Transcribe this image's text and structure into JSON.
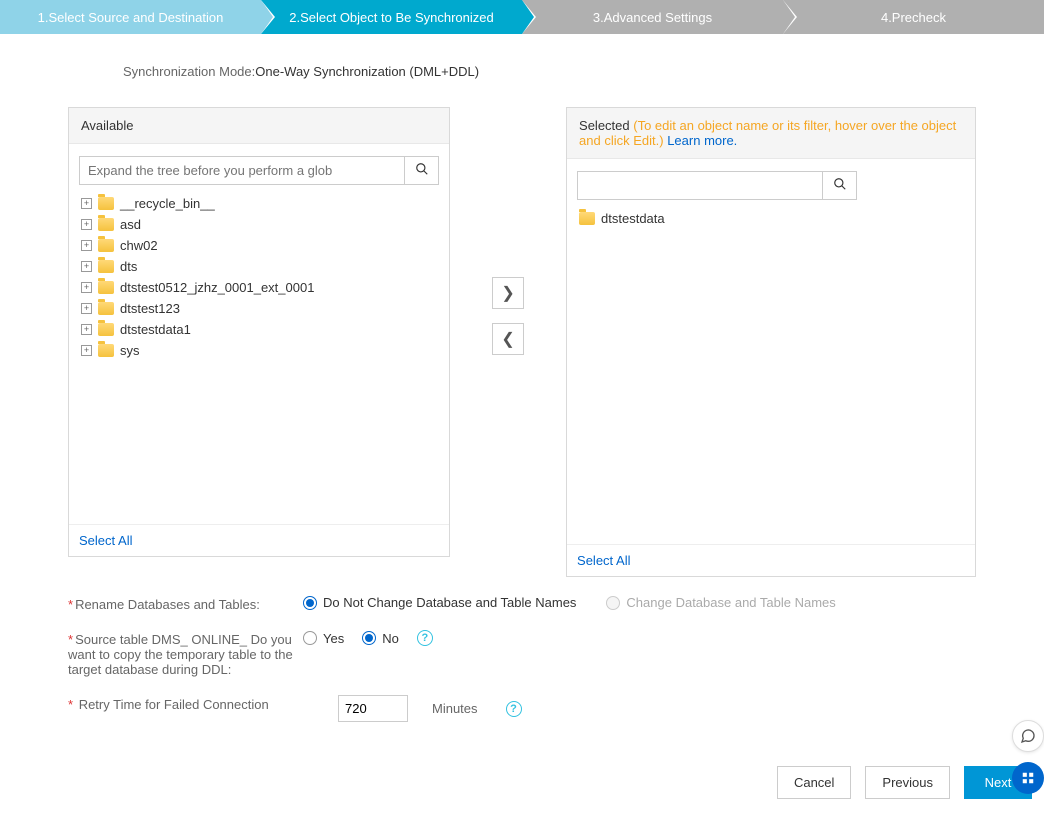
{
  "steps": {
    "s1": "1.Select Source and Destination",
    "s2": "2.Select Object to Be Synchronized",
    "s3": "3.Advanced Settings",
    "s4": "4.Precheck"
  },
  "sync_mode": {
    "label": "Synchronization Mode:",
    "value": "One-Way Synchronization (DML+DDL)"
  },
  "available": {
    "title": "Available",
    "search_placeholder": "Expand the tree before you perform a glob",
    "select_all": "Select All",
    "items": [
      "__recycle_bin__",
      "asd",
      "chw02",
      "dts",
      "dtstest0512_jzhz_0001_ext_0001",
      "dtstest123",
      "dtstestdata1",
      "sys"
    ]
  },
  "selected": {
    "title": "Selected",
    "hint": "(To edit an object name or its filter, hover over the object and click Edit.)",
    "learn_more": "Learn more.",
    "select_all": "Select All",
    "items": [
      "dtstestdata"
    ]
  },
  "options": {
    "rename": {
      "label": "Rename Databases and Tables:",
      "opt1": "Do Not Change Database and Table Names",
      "opt2": "Change Database and Table Names"
    },
    "dms": {
      "label": "Source table DMS_ ONLINE_ Do you want to copy the temporary table to the target database during DDL:",
      "yes": "Yes",
      "no": "No"
    },
    "retry": {
      "label": "Retry Time for Failed Connection",
      "value": "720",
      "unit": "Minutes"
    }
  },
  "buttons": {
    "cancel": "Cancel",
    "previous": "Previous",
    "next": "Next"
  }
}
